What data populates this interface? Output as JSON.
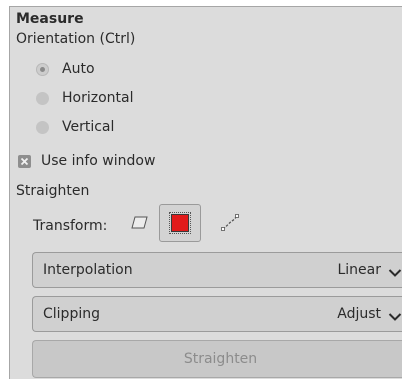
{
  "tool_options": {
    "title": "Measure",
    "orientation": {
      "label": "Orientation  (Ctrl)",
      "options": [
        {
          "label": "Auto",
          "selected": true
        },
        {
          "label": "Horizontal",
          "selected": false
        },
        {
          "label": "Vertical",
          "selected": false
        }
      ]
    },
    "use_info_window": {
      "label": "Use info window",
      "checked": true
    },
    "straighten_section": "Straighten",
    "transform": {
      "label": "Transform:",
      "icons": [
        "transform-layer-icon",
        "transform-selection-icon",
        "transform-path-icon"
      ],
      "active": "transform-selection-icon"
    },
    "interpolation": {
      "label": "Interpolation",
      "value": "Linear"
    },
    "clipping": {
      "label": "Clipping",
      "value": "Adjust"
    },
    "straighten_button": "Straighten"
  },
  "colors": {
    "swatch": "#e21b1b",
    "panel_bg": "#dcdcdc"
  }
}
